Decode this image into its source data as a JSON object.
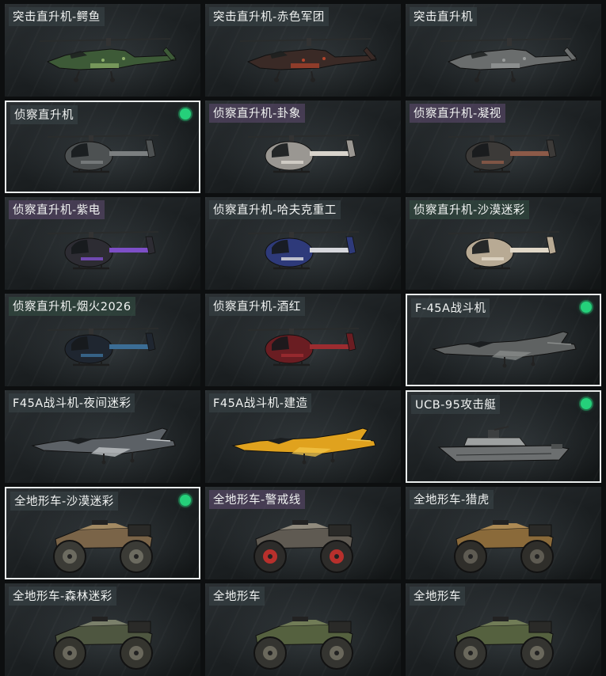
{
  "items": [
    {
      "name": "突击直升机-鳄鱼",
      "kind": "attack-heli",
      "body": "#3d5a37",
      "accent": "#8fb06a",
      "tag": "default"
    },
    {
      "name": "突击直升机-赤色军团",
      "kind": "attack-heli",
      "body": "#3a2a26",
      "accent": "#b4452c",
      "tag": "default"
    },
    {
      "name": "突击直升机",
      "kind": "attack-heli",
      "body": "#6a6d6d",
      "accent": "#9a9d9c",
      "tag": "default"
    },
    {
      "name": "侦察直升机",
      "kind": "scout-heli",
      "body": "#4d5152",
      "accent": "#7b7f80",
      "tag": "default",
      "owned": true,
      "selected": true
    },
    {
      "name": "侦察直升机-卦象",
      "kind": "scout-heli",
      "body": "#9a9792",
      "accent": "#d8d4cc",
      "tag": "purple"
    },
    {
      "name": "侦察直升机-凝视",
      "kind": "scout-heli",
      "body": "#3c3a38",
      "accent": "#8c5a48",
      "tag": "purple"
    },
    {
      "name": "侦察直升机-紫电",
      "kind": "scout-heli",
      "body": "#2d2c33",
      "accent": "#7d4fc7",
      "tag": "purple"
    },
    {
      "name": "侦察直升机-哈夫克重工",
      "kind": "scout-heli",
      "body": "#2e3a7a",
      "accent": "#d6d7dc",
      "tag": "default"
    },
    {
      "name": "侦察直升机-沙漠迷彩",
      "kind": "scout-heli",
      "body": "#b8aa94",
      "accent": "#e1d8c8",
      "tag": "green"
    },
    {
      "name": "侦察直升机-烟火2026",
      "kind": "scout-heli",
      "body": "#1f2630",
      "accent": "#3b6d95",
      "tag": "green"
    },
    {
      "name": "侦察直升机-酒红",
      "kind": "scout-heli",
      "body": "#6a1d22",
      "accent": "#9c2c30",
      "tag": "default"
    },
    {
      "name": "F-45A战斗机",
      "kind": "jet",
      "body": "#5f6262",
      "accent": "#8a8d8c",
      "tag": "default",
      "owned": true,
      "selected": true
    },
    {
      "name": "F45A战斗机-夜间迷彩",
      "kind": "jet",
      "body": "#5c6166",
      "accent": "#c5c9cc",
      "tag": "default"
    },
    {
      "name": "F45A战斗机-建造",
      "kind": "jet",
      "body": "#e0a21e",
      "accent": "#f3c64a",
      "tag": "default"
    },
    {
      "name": "UCB-95攻击艇",
      "kind": "boat",
      "body": "#6c6f70",
      "accent": "#9ea1a1",
      "tag": "default",
      "owned": true,
      "selected": true
    },
    {
      "name": "全地形车-沙漠迷彩",
      "kind": "atv",
      "body": "#7a6448",
      "accent": "#b89a6c",
      "wheel": "#3b3b36",
      "rim": "#6c6b60",
      "tag": "default",
      "owned": true,
      "selected": true
    },
    {
      "name": "全地形车-警戒线",
      "kind": "atv",
      "body": "#5f5a52",
      "accent": "#a39b8c",
      "wheel": "#2d2c2a",
      "rim": "#b8302c",
      "tag": "purple"
    },
    {
      "name": "全地形车-猎虎",
      "kind": "atv",
      "body": "#8a6a3a",
      "accent": "#c49a5a",
      "wheel": "#2f2e2a",
      "rim": "#5e5b52",
      "tag": "default"
    },
    {
      "name": "全地形车-森林迷彩",
      "kind": "atv",
      "body": "#4e5640",
      "accent": "#8a8e76",
      "wheel": "#35352f",
      "rim": "#6a685c",
      "tag": "default"
    },
    {
      "name": "全地形车",
      "kind": "atv",
      "body": "#55613f",
      "accent": "#7e8a5e",
      "wheel": "#343430",
      "rim": "#6a685c",
      "tag": "default"
    },
    {
      "name": "全地形车",
      "kind": "atv",
      "body": "#55613f",
      "accent": "#7e8a5e",
      "wheel": "#343430",
      "rim": "#6a685c",
      "tag": "default"
    }
  ]
}
